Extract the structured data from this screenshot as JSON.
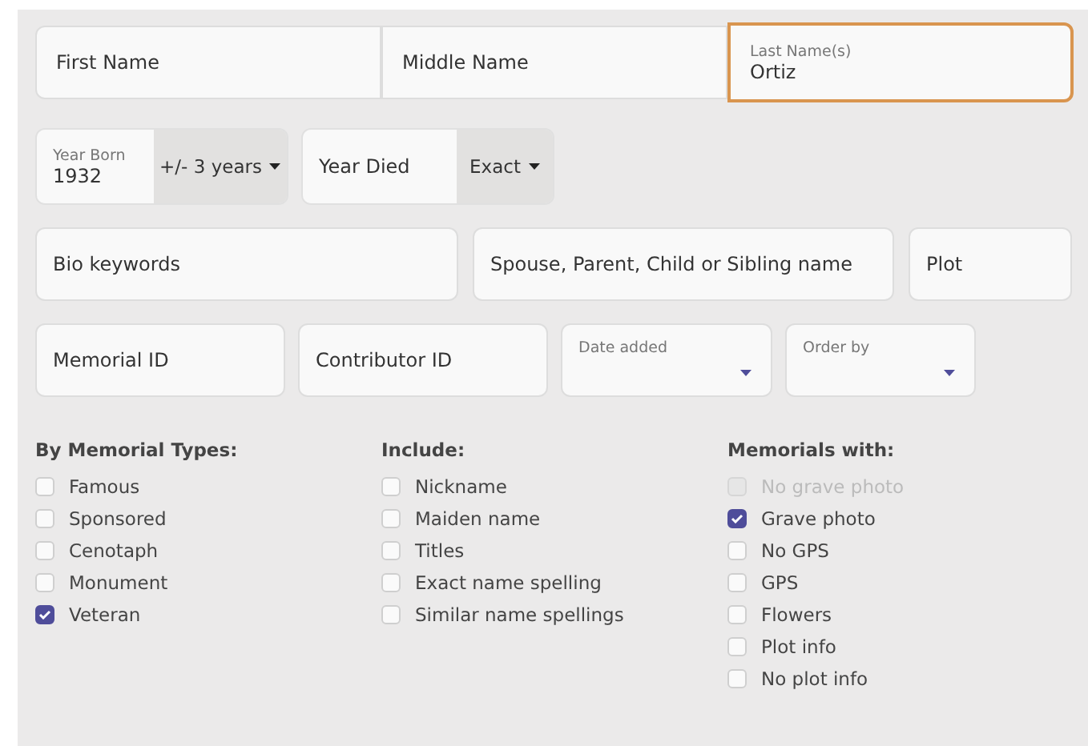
{
  "name_fields": [
    {
      "label": "First Name",
      "focused": false
    },
    {
      "label": "Middle Name",
      "focused": false
    },
    {
      "label": "Last Name(s)",
      "value": "Ortiz",
      "focused": true
    }
  ],
  "year_fields": [
    {
      "label": "Year Born",
      "value": "1932",
      "range": "+/- 3 years"
    },
    {
      "label": "Year Died",
      "range": "Exact"
    }
  ],
  "text_fields": [
    {
      "label": "Bio keywords"
    },
    {
      "label": "Spouse, Parent, Child or Sibling name"
    },
    {
      "label": "Plot"
    }
  ],
  "id_fields": [
    {
      "kind": "text",
      "label": "Memorial ID"
    },
    {
      "kind": "text",
      "label": "Contributor ID"
    },
    {
      "kind": "select",
      "label": "Date added"
    },
    {
      "kind": "select",
      "label": "Order by"
    }
  ],
  "filter_groups": [
    {
      "heading": "By Memorial Types:",
      "options": [
        {
          "label": "Famous",
          "checked": false,
          "disabled": false
        },
        {
          "label": "Sponsored",
          "checked": false,
          "disabled": false
        },
        {
          "label": "Cenotaph",
          "checked": false,
          "disabled": false
        },
        {
          "label": "Monument",
          "checked": false,
          "disabled": false
        },
        {
          "label": "Veteran",
          "checked": true,
          "disabled": false
        }
      ]
    },
    {
      "heading": "Include:",
      "options": [
        {
          "label": "Nickname",
          "checked": false,
          "disabled": false
        },
        {
          "label": "Maiden name",
          "checked": false,
          "disabled": false
        },
        {
          "label": "Titles",
          "checked": false,
          "disabled": false
        },
        {
          "label": "Exact name spelling",
          "checked": false,
          "disabled": false
        },
        {
          "label": "Similar name spellings",
          "checked": false,
          "disabled": false
        }
      ]
    },
    {
      "heading": "Memorials with:",
      "options": [
        {
          "label": "No grave photo",
          "checked": false,
          "disabled": true
        },
        {
          "label": "Grave photo",
          "checked": true,
          "disabled": false
        },
        {
          "label": "No GPS",
          "checked": false,
          "disabled": false
        },
        {
          "label": "GPS",
          "checked": false,
          "disabled": false
        },
        {
          "label": "Flowers",
          "checked": false,
          "disabled": false
        },
        {
          "label": "Plot info",
          "checked": false,
          "disabled": false
        },
        {
          "label": "No plot info",
          "checked": false,
          "disabled": false
        }
      ]
    }
  ]
}
